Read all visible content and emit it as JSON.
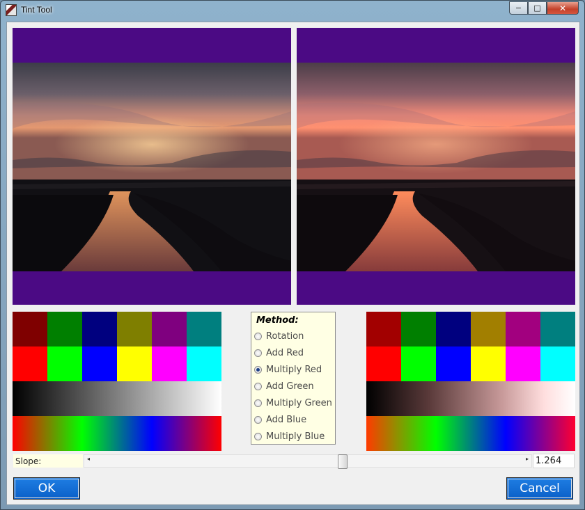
{
  "window": {
    "title": "Tint Tool",
    "controls": {
      "minimize": "−",
      "maximize": "□",
      "close": "✕"
    }
  },
  "colors": {
    "border_purple": "#4b0a84",
    "method_background": "#ffffe4",
    "button_blue": "#0a66d4"
  },
  "images": {
    "original": {
      "icon": "sunset-canal-photo"
    },
    "tinted": {
      "icon": "sunset-canal-photo-tinted"
    }
  },
  "swatches_original": {
    "dark_row": [
      "#7f0000",
      "#007f00",
      "#00007f",
      "#7f7f00",
      "#7f007f",
      "#007f7f"
    ],
    "bright_row": [
      "#ff0000",
      "#00ff00",
      "#0000ff",
      "#ffff00",
      "#ff00ff",
      "#00ffff"
    ],
    "gray_ramp": [
      "#000000",
      "#ffffff"
    ],
    "hue_ramp": [
      "#ff0000",
      "#00ff00",
      "#0000ff",
      "#ff0000"
    ]
  },
  "swatches_tinted": {
    "dark_row": [
      "#a20000",
      "#007f00",
      "#00007f",
      "#a27f00",
      "#a2007f",
      "#007f7f"
    ],
    "bright_row": [
      "#ff0000",
      "#00ff00",
      "#0000ff",
      "#ffff00",
      "#ff00ff",
      "#00ffff"
    ],
    "gray_ramp": [
      "#000000",
      "#ffffff"
    ],
    "hue_ramp": [
      "#ff3a00",
      "#00ff00",
      "#0000ff",
      "#ff0030"
    ]
  },
  "method": {
    "title": "Method:",
    "options": [
      {
        "label": "Rotation",
        "selected": false
      },
      {
        "label": "Add Red",
        "selected": false
      },
      {
        "label": "Multiply Red",
        "selected": true
      },
      {
        "label": "Add Green",
        "selected": false
      },
      {
        "label": "Multiply Green",
        "selected": false
      },
      {
        "label": "Add Blue",
        "selected": false
      },
      {
        "label": "Multiply Blue",
        "selected": false
      }
    ]
  },
  "slope": {
    "label": "Slope:",
    "value": "1.264",
    "scroll_position": 0.583,
    "left_arrow": "◂",
    "right_arrow": "▸"
  },
  "buttons": {
    "ok": "OK",
    "cancel": "Cancel"
  }
}
